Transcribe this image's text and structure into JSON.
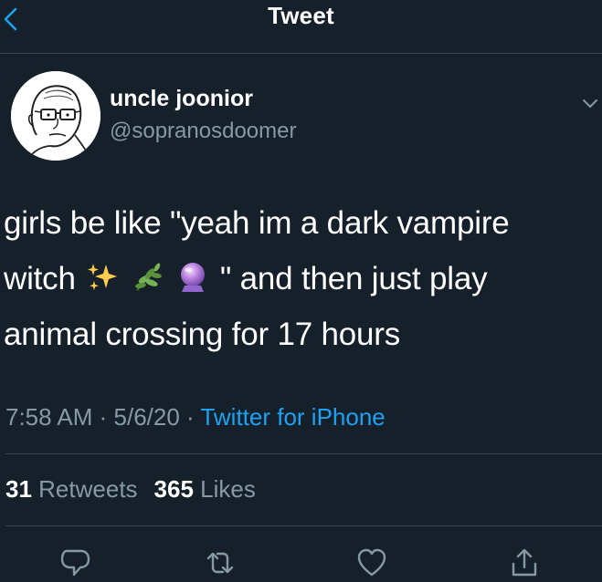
{
  "header": {
    "title": "Tweet"
  },
  "author": {
    "display_name": "uncle joonior",
    "handle": "@sopranosdoomer"
  },
  "tweet": {
    "text_1": "girls be like \"yeah im a dark vampire",
    "text_2_before": "witch",
    "text_2_after": "\" and then just play",
    "text_3": "animal crossing for 17 hours",
    "emojis": [
      "sparkles-icon",
      "herb-icon",
      "crystal-ball-icon"
    ]
  },
  "meta": {
    "time": "7:58 AM",
    "sep1": " · ",
    "date": "5/6/20",
    "sep2": " · ",
    "source": "Twitter for iPhone"
  },
  "stats": {
    "retweets_count": "31",
    "retweets_label": "Retweets",
    "likes_count": "365",
    "likes_label": "Likes"
  },
  "colors": {
    "background": "#15202b",
    "text": "#ffffff",
    "secondary": "#8899a6",
    "accent": "#1da1f2",
    "divider": "#38444d"
  }
}
